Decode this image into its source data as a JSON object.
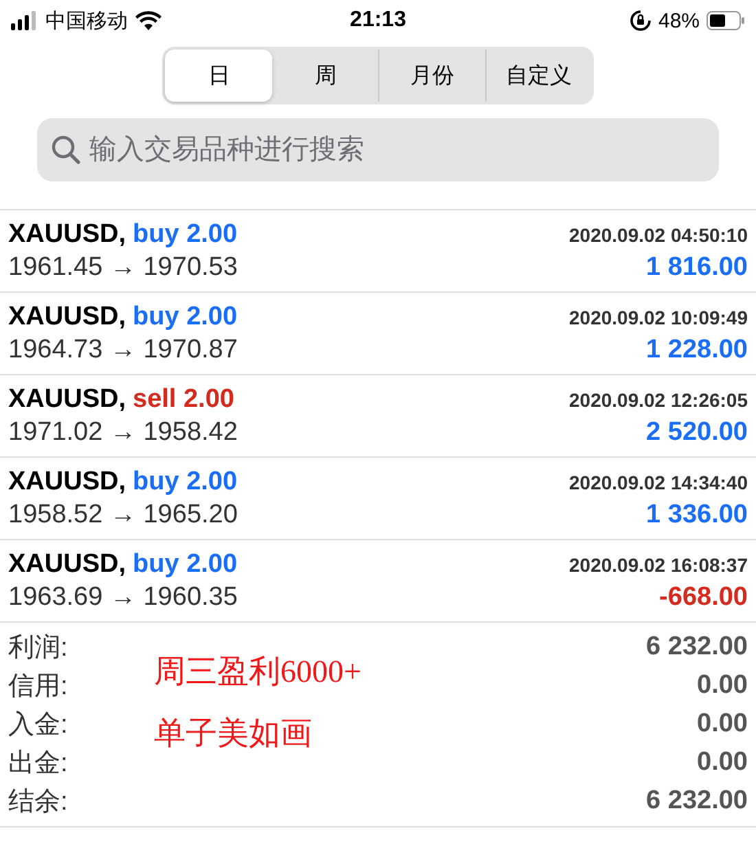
{
  "status_bar": {
    "carrier": "中国移动",
    "time": "21:13",
    "battery": "48%"
  },
  "tabs": [
    {
      "label": "日",
      "selected": true
    },
    {
      "label": "周",
      "selected": false
    },
    {
      "label": "月份",
      "selected": false
    },
    {
      "label": "自定义",
      "selected": false
    }
  ],
  "search": {
    "placeholder": "输入交易品种进行搜索"
  },
  "trades": [
    {
      "symbol": "XAUUSD,",
      "sell": false,
      "order": "buy 2.00",
      "time": "2020.09.02 04:50:10",
      "prices": "1961.45 → 1970.53",
      "profit": "1 816.00",
      "negative": false
    },
    {
      "symbol": "XAUUSD,",
      "sell": false,
      "order": "buy 2.00",
      "time": "2020.09.02 10:09:49",
      "prices": "1964.73 → 1970.87",
      "profit": "1 228.00",
      "negative": false
    },
    {
      "symbol": "XAUUSD,",
      "sell": true,
      "order": "sell 2.00",
      "time": "2020.09.02 12:26:05",
      "prices": "1971.02 → 1958.42",
      "profit": "2 520.00",
      "negative": false
    },
    {
      "symbol": "XAUUSD,",
      "sell": false,
      "order": "buy 2.00",
      "time": "2020.09.02 14:34:40",
      "prices": "1958.52 → 1965.20",
      "profit": "1 336.00",
      "negative": false
    },
    {
      "symbol": "XAUUSD,",
      "sell": false,
      "order": "buy 2.00",
      "time": "2020.09.02 16:08:37",
      "prices": "1963.69 → 1960.35",
      "profit": "-668.00",
      "negative": true
    }
  ],
  "summary": [
    {
      "label": "利润:",
      "value": "6 232.00"
    },
    {
      "label": "信用:",
      "value": "0.00"
    },
    {
      "label": "入金:",
      "value": "0.00"
    },
    {
      "label": "出金:",
      "value": "0.00"
    },
    {
      "label": "结余:",
      "value": "6 232.00"
    }
  ],
  "annotation": [
    "周三盈利6000+",
    "单子美如画"
  ]
}
